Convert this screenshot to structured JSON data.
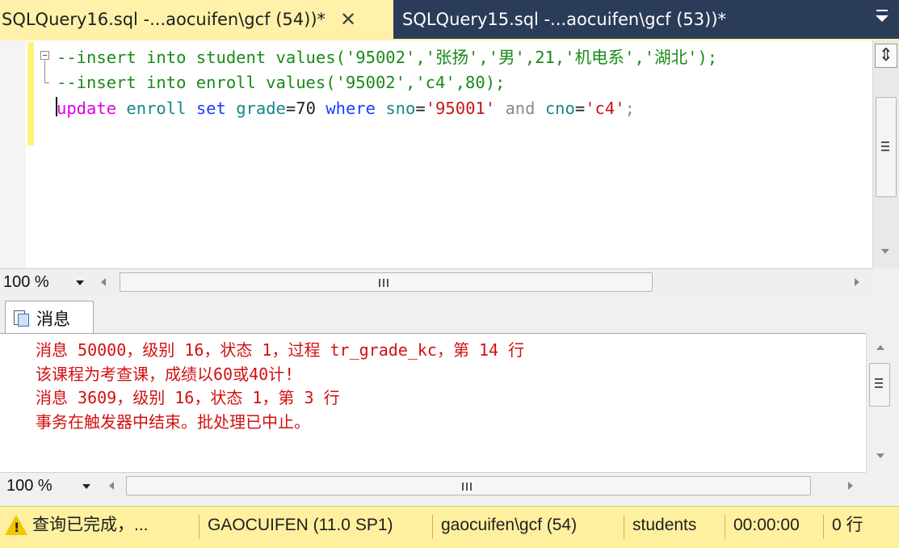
{
  "tabs": {
    "active": {
      "title": "SQLQuery16.sql -...aocuifen\\gcf (54))*",
      "close": "✕"
    },
    "inactive": {
      "title": "SQLQuery15.sql -...aocuifen\\gcf (53))*"
    }
  },
  "editor": {
    "line1": "--insert into student values('95002','张扬','男',21,'机电系','湖北');",
    "line2": "--insert into enroll values('95002','c4',80);",
    "line3": {
      "update": "update",
      "enroll": "enroll",
      "set": "set",
      "grade": "grade",
      "eq1": "=",
      "val70": "70",
      "where": "where",
      "sno": "sno",
      "eq2": "=",
      "sno_val": "'95001'",
      "and": "and",
      "cno": "cno",
      "eq3": "=",
      "cno_val": "'c4'",
      "semi": ";"
    },
    "zoom": "100 %"
  },
  "results": {
    "tab_label": "消息",
    "messages": [
      "消息 50000，级别 16，状态 1，过程 tr_grade_kc，第 14 行",
      "该课程为考查课，成绩以60或40计!",
      "消息 3609，级别 16，状态 1，第 3 行",
      "事务在触发器中结束。批处理已中止。"
    ],
    "zoom": "100 %"
  },
  "status": {
    "query_status": "查询已完成，...",
    "server": "GAOCUIFEN (11.0 SP1)",
    "login": "gaocuifen\\gcf (54)",
    "database": "students",
    "elapsed": "00:00:00",
    "rows": "0 行"
  },
  "colors": {
    "tab_active": "#fff1a9",
    "tab_strip": "#2b3c59",
    "status_bar": "#fff0a0",
    "error_text": "#d21010",
    "comment": "#1a8a1a",
    "keyword": "#1a3cff"
  }
}
